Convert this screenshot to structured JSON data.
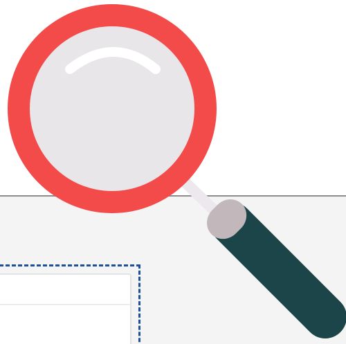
{
  "illustration": {
    "subject": "magnifying-glass-icon",
    "colors": {
      "rim": "#f24b4a",
      "lens": "#e9e6ea",
      "lens_highlight": "#ffffff",
      "neck": "#ece8ee",
      "ferrule": "#c2b8bc",
      "handle": "#1c4549",
      "panel": "#f4f4f4",
      "panel_border": "#8c8c8c",
      "selection": "#1e4f9a",
      "window_border": "#e3e3e3"
    }
  }
}
